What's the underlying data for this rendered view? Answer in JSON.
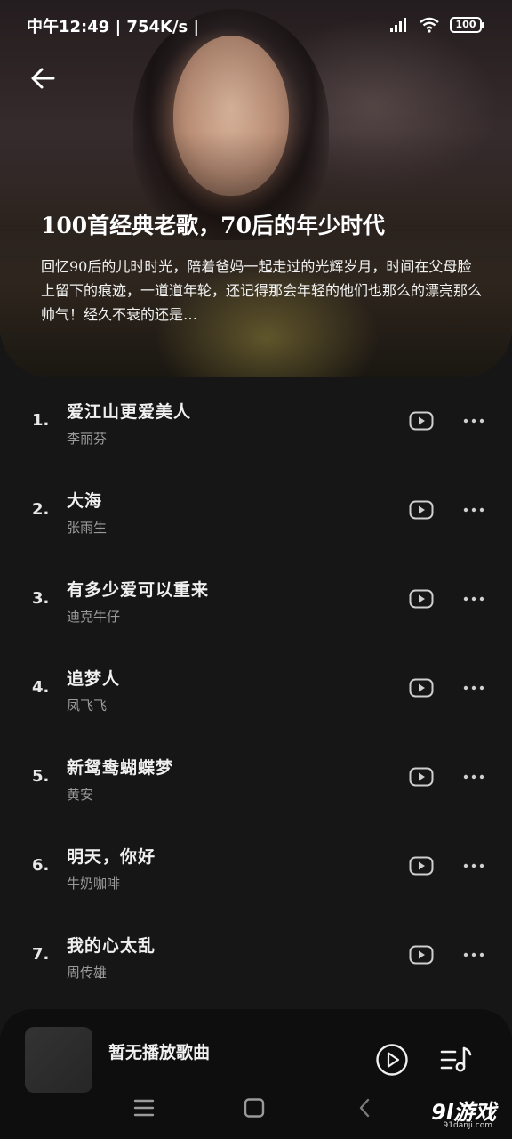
{
  "status_bar": {
    "time": "中午12:49",
    "network_speed": "754K/s",
    "battery": "100"
  },
  "playlist": {
    "title": "100首经典老歌，70后的年少时代",
    "description": "回忆90后的儿时时光，陪着爸妈一起走过的光辉岁月，时间在父母脸上留下的痕迹，一道道年轮，还记得那会年轻的他们也那么的漂亮那么帅气！经久不衰的还是…"
  },
  "songs": [
    {
      "num": "1.",
      "title": "爱江山更爱美人",
      "artist": "李丽芬"
    },
    {
      "num": "2.",
      "title": "大海",
      "artist": "张雨生"
    },
    {
      "num": "3.",
      "title": "有多少爱可以重来",
      "artist": "迪克牛仔"
    },
    {
      "num": "4.",
      "title": "追梦人",
      "artist": "凤飞飞"
    },
    {
      "num": "5.",
      "title": "新鸳鸯蝴蝶梦",
      "artist": "黄安"
    },
    {
      "num": "6.",
      "title": "明天，你好",
      "artist": "牛奶咖啡"
    },
    {
      "num": "7.",
      "title": "我的心太乱",
      "artist": "周传雄"
    }
  ],
  "player": {
    "now_playing": "暂无播放歌曲"
  },
  "watermark": {
    "text": "9l游戏",
    "sub": "91danji.com"
  }
}
